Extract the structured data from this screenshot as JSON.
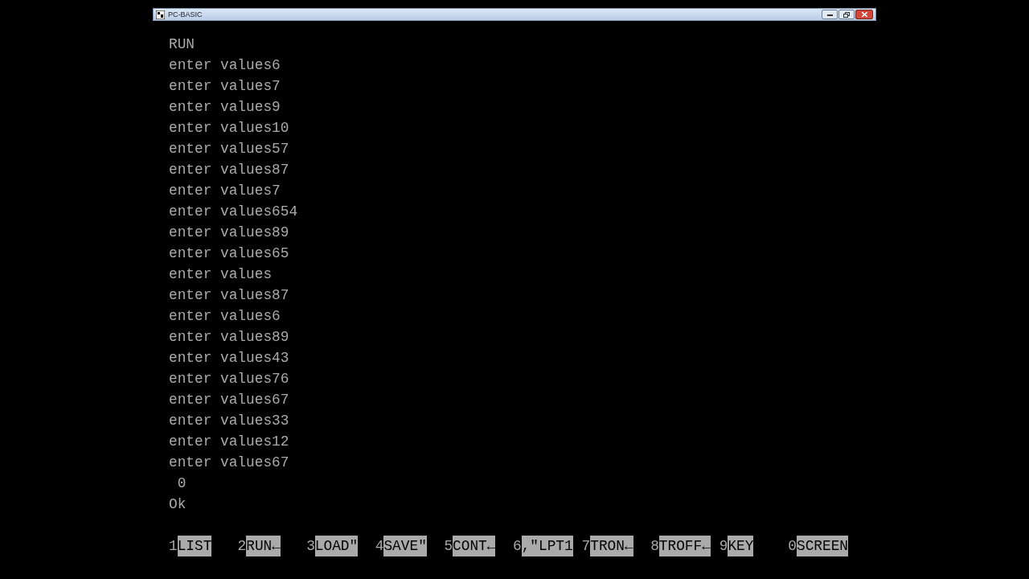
{
  "window": {
    "title": "PC-BASIC"
  },
  "screen_lines": [
    "RUN",
    "enter values6",
    "enter values7",
    "enter values9",
    "enter values10",
    "enter values57",
    "enter values87",
    "enter values7",
    "enter values654",
    "enter values89",
    "enter values65",
    "enter values",
    "enter values87",
    "enter values6",
    "enter values89",
    "enter values43",
    "enter values76",
    "enter values67",
    "enter values33",
    "enter values12",
    "enter values67",
    " 0",
    "Ok"
  ],
  "function_keys": [
    {
      "number": "1",
      "label": "LIST"
    },
    {
      "number": "2",
      "label": "RUN←"
    },
    {
      "number": "3",
      "label": "LOAD\""
    },
    {
      "number": "4",
      "label": "SAVE\""
    },
    {
      "number": "5",
      "label": "CONT←"
    },
    {
      "number": "6",
      "label": ",\"LPT1"
    },
    {
      "number": "7",
      "label": "TRON←"
    },
    {
      "number": "8",
      "label": "TROFF←"
    },
    {
      "number": "9",
      "label": "KEY"
    },
    {
      "number": "0",
      "label": "SCREEN"
    }
  ]
}
